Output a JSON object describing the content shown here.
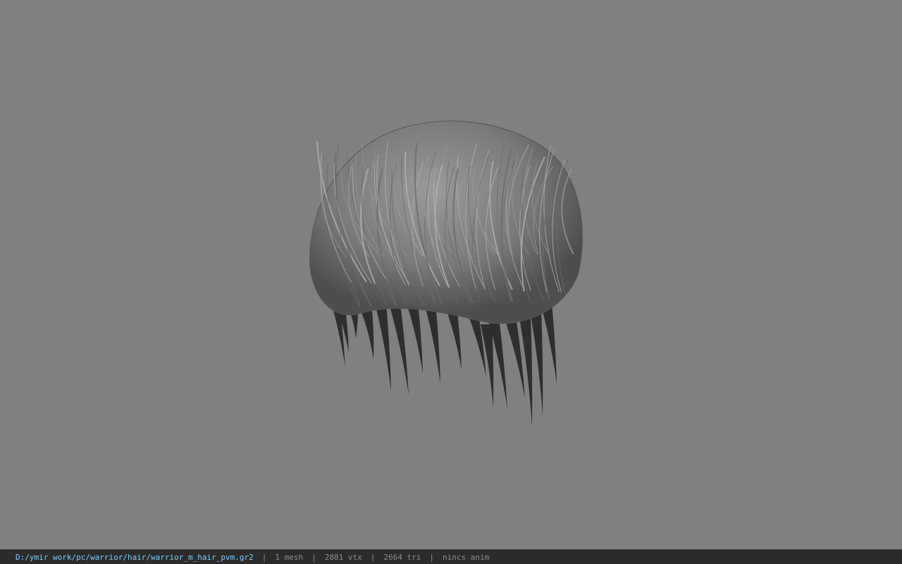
{
  "viewport": {
    "model_name": "warrior_m_hair_pvm",
    "background_color": "#808080",
    "model_color": "#8a8a8a"
  },
  "status_bar": {
    "file_path": "D:/ymir work/pc/warrior/hair/warrior_m_hair_pvm.gr2",
    "mesh_count": "1 mesh",
    "vertex_count": "2881 vtx",
    "triangle_count": "2664 tri",
    "animation": "nincs anim",
    "separator": "|",
    "path_color": "#7fd0ff"
  }
}
